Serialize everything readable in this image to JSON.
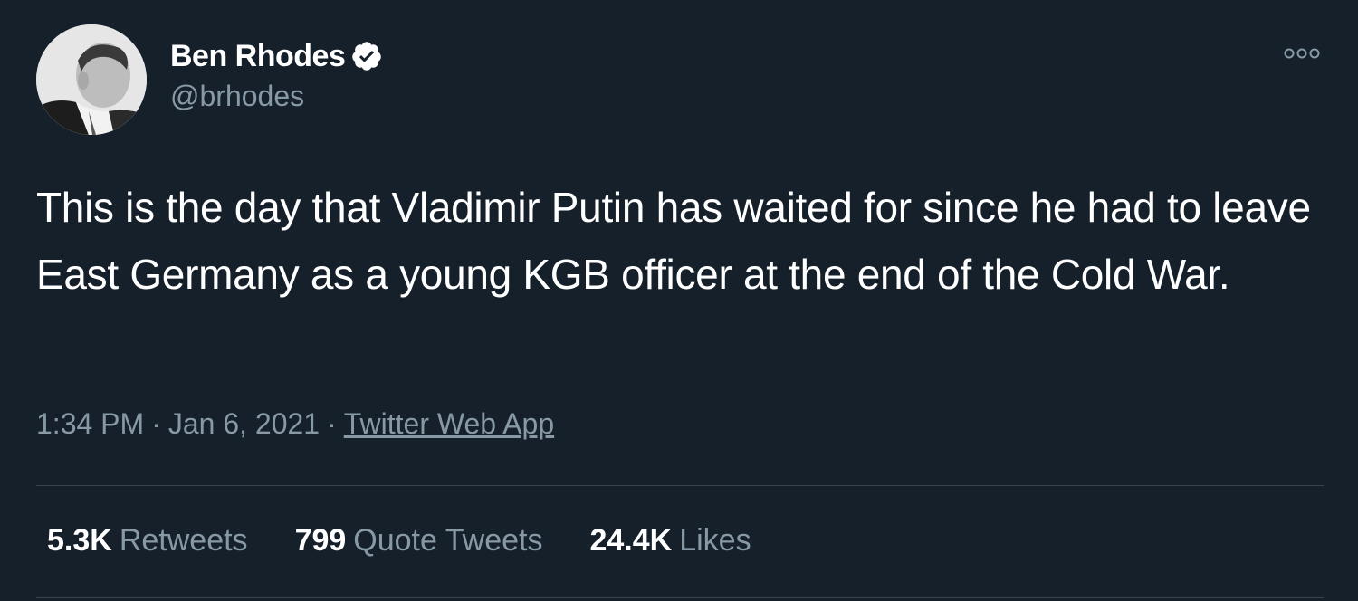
{
  "author": {
    "display_name": "Ben Rhodes",
    "handle": "@brhodes",
    "verified": true,
    "verified_color": "#ffffff",
    "avatar_icon": "user-photo"
  },
  "menu": {
    "icon": "more-options-icon"
  },
  "tweet": {
    "text": "This is the day that Vladimir Putin has waited for since he had to leave East Germany as a young KGB officer at the end of the Cold War."
  },
  "meta": {
    "time": "1:34 PM",
    "separator": "·",
    "date": "Jan 6, 2021",
    "source": "Twitter Web App"
  },
  "stats": {
    "retweets": {
      "value": "5.3K",
      "label": "Retweets"
    },
    "quote_tweets": {
      "value": "799",
      "label": "Quote Tweets"
    },
    "likes": {
      "value": "24.4K",
      "label": "Likes"
    }
  },
  "colors": {
    "background": "#15202b",
    "primary_text": "#ffffff",
    "secondary_text": "#8899a6",
    "divider": "#38444d"
  }
}
